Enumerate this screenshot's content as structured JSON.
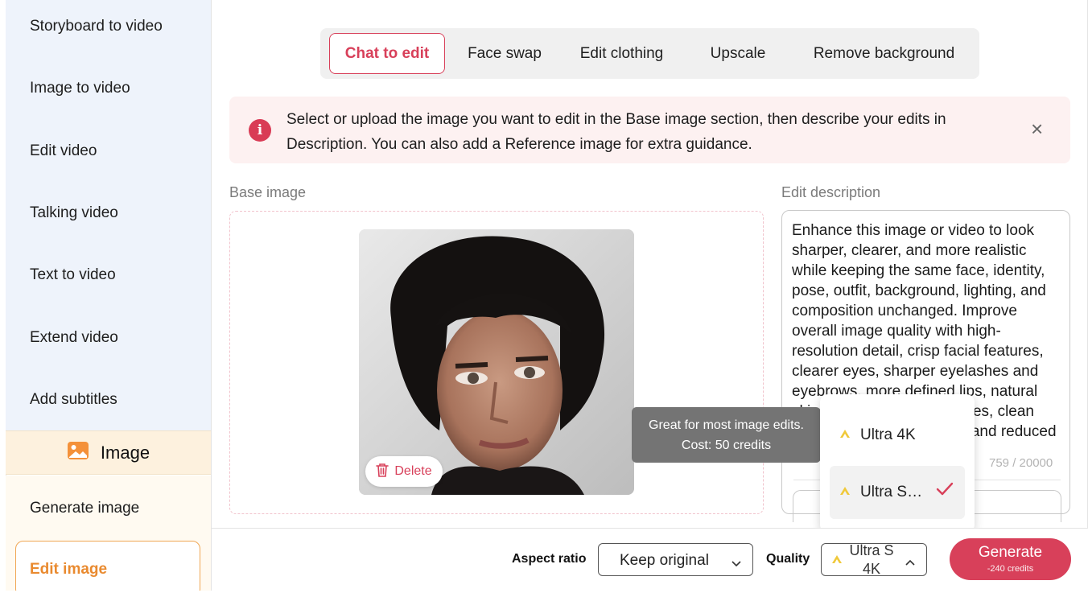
{
  "sidebar": {
    "video_items": [
      {
        "label": "Storyboard to video"
      },
      {
        "label": "Image to video"
      },
      {
        "label": "Edit video"
      },
      {
        "label": "Talking video"
      },
      {
        "label": "Text to video"
      },
      {
        "label": "Extend video"
      },
      {
        "label": "Add subtitles"
      }
    ],
    "image_group": {
      "label": "Image",
      "icon": "image-icon",
      "items": [
        {
          "label": "Generate image"
        },
        {
          "label": "Edit image",
          "active": true
        }
      ]
    }
  },
  "tabs": [
    {
      "label": "Chat to edit",
      "active": true
    },
    {
      "label": "Face swap"
    },
    {
      "label": "Edit clothing"
    },
    {
      "label": "Upscale"
    },
    {
      "label": "Remove background"
    }
  ],
  "notice": {
    "text": "Select or upload the image you want to edit in the Base image section, then describe your edits in Description. You can also add a Reference image for extra guidance.",
    "icon": "info-icon",
    "close": "×"
  },
  "base_image": {
    "label": "Base image",
    "delete_label": "Delete"
  },
  "description": {
    "label": "Edit description",
    "text": "Enhance this image or video to look sharper, clearer, and more realistic while keeping the same face, identity, pose, outfit, background, lighting, and composition unchanged. Improve overall image quality with high-resolution detail, crisp facial features, clearer eyes, sharper eyelashes and eyebrows, more defined lips, natural skin texture with subtle pores, clean edges, balanced contrast, and reduced noise.",
    "char_count": "759 / 20000"
  },
  "tooltip": {
    "line1": "Great for most image edits.",
    "line2": "Cost: 50 credits"
  },
  "quality_menu": {
    "options": [
      {
        "label": "Ultra 4K",
        "selected": false
      },
      {
        "label": "Ultra S…",
        "selected": true
      }
    ]
  },
  "bottom_bar": {
    "aspect_label": "Aspect ratio",
    "aspect_value": "Keep original",
    "quality_label": "Quality",
    "quality_value_l1": "Ultra S",
    "quality_value_l2": "4K",
    "generate_label": "Generate",
    "generate_cost": "-240 credits"
  },
  "colors": {
    "accent": "#d8405a",
    "orange": "#e98a2f",
    "sidebar_video_bg": "#eef3fb",
    "sidebar_image_bg": "#fdf1de",
    "bolt": "#f0c93a"
  }
}
